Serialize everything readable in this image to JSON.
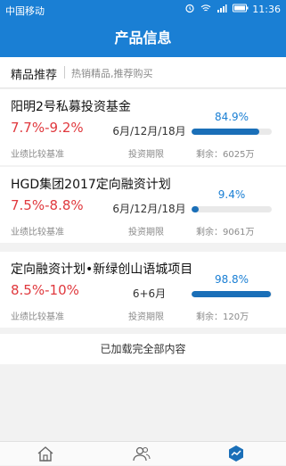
{
  "status": {
    "carrier": "中国移动",
    "time": "11:36"
  },
  "header": {
    "title": "产品信息"
  },
  "section": {
    "label": "精品推荐",
    "subtitle": "热销精品,推荐购买"
  },
  "products": [
    {
      "name": "阳明2号私募投资基金",
      "rate": "7.7%-9.2%",
      "term": "6月/12月/18月",
      "progress_text": "84.9%",
      "progress": 0.849,
      "rate_label": "业绩比较基准",
      "term_label": "投资期限",
      "remaining": "剩余：6025万"
    },
    {
      "name": "HGD集团2017定向融资计划",
      "rate": "7.5%-8.8%",
      "term": "6月/12月/18月",
      "progress_text": "9.4%",
      "progress": 0.094,
      "rate_label": "业绩比较基准",
      "term_label": "投资期限",
      "remaining": "剩余：9061万"
    },
    {
      "name": "定向融资计划•新绿创山语城项目",
      "rate": "8.5%-10%",
      "term": "6+6月",
      "progress_text": "98.8%",
      "progress": 0.988,
      "rate_label": "业绩比较基准",
      "term_label": "投资期限",
      "remaining": "剩余：120万"
    }
  ],
  "footer_message": "已加载完全部内容",
  "tabs": [
    {
      "icon": "home-icon",
      "active": false
    },
    {
      "icon": "users-icon",
      "active": false
    },
    {
      "icon": "chart-icon",
      "active": true
    }
  ],
  "colors": {
    "primary": "#1a7fd4",
    "rate": "#e0393e",
    "bar": "#1a6fb8"
  }
}
